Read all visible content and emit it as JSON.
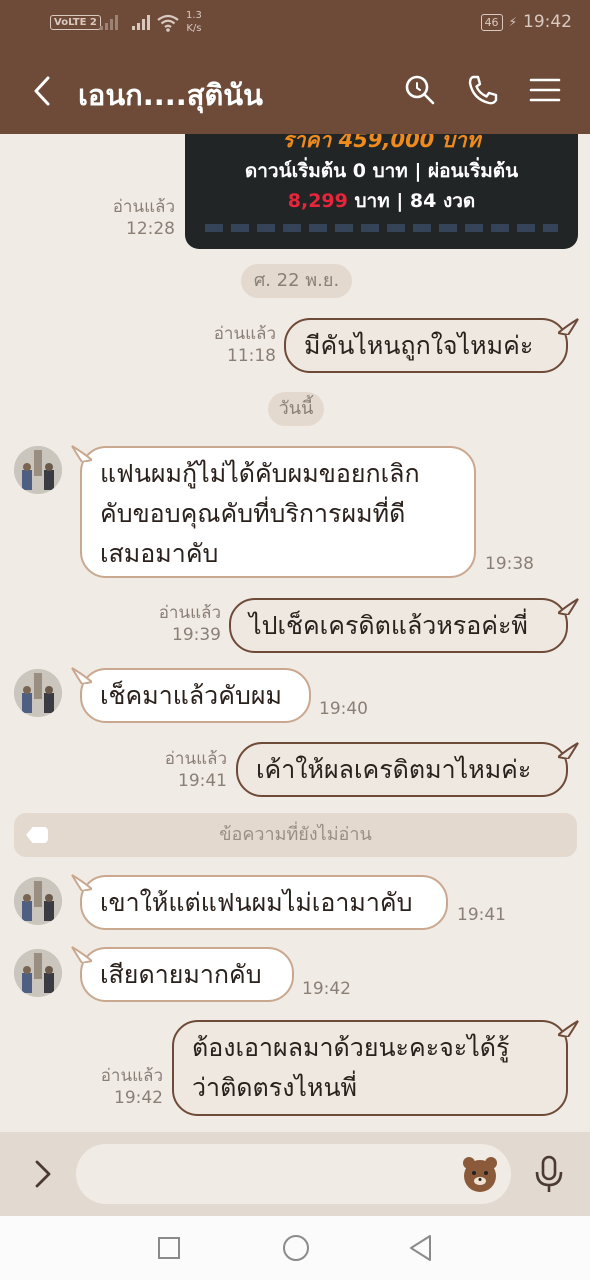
{
  "status_bar": {
    "carrier_badge": "VoLTE 2",
    "net_speed_value": "1.3",
    "net_speed_unit": "K/s",
    "battery": "46",
    "time": "19:42"
  },
  "header": {
    "title": "เอนก....สุตินัน",
    "icons": [
      "back-arrow-icon",
      "search-icon",
      "phone-icon",
      "menu-icon"
    ]
  },
  "promo": {
    "price_line": "ราคา 459,000 บาท",
    "down_line": "ดาวน์เริ่มต้น 0 บาท | ผ่อนเริ่มต้น",
    "install_amount": "8,299",
    "install_rest": "บาท | 84 งวด"
  },
  "promo_meta": {
    "read": "อ่านแล้ว",
    "time": "12:28"
  },
  "dates": {
    "friday": "ศ. 22 พ.ย.",
    "today": "วันนี้"
  },
  "messages": [
    {
      "dir": "out",
      "text": "มีคันไหนถูกใจไหมค่ะ",
      "read": "อ่านแล้ว",
      "time": "11:18"
    },
    {
      "dir": "in",
      "lines": [
        "แฟนผมกู้ไม่ได้คับผมขอยกเลิก",
        "คับขอบคุณคับที่บริการผมที่ดี",
        "เสมอมาคับ"
      ],
      "time": "19:38"
    },
    {
      "dir": "out",
      "text": "ไปเช็คเครดิตแล้วหรอค่ะพี่",
      "read": "อ่านแล้ว",
      "time": "19:39"
    },
    {
      "dir": "in",
      "text": "เช็คมาแล้วคับผม",
      "time": "19:40"
    },
    {
      "dir": "out",
      "text": "เค้าให้ผลเครดิตมาไหมค่ะ",
      "read": "อ่านแล้ว",
      "time": "19:41"
    },
    {
      "dir": "in",
      "text": "เขาให้แต่แฟนผมไม่เอามาคับ",
      "time": "19:41"
    },
    {
      "dir": "in",
      "text": "เสียดายมากคับ",
      "time": "19:42"
    },
    {
      "dir": "out",
      "lines": [
        "ต้องเอาผลมาด้วยนะคะจะได้รู้",
        "ว่าติดตรงไหนพี่"
      ],
      "read": "อ่านแล้ว",
      "time": "19:42"
    }
  ],
  "unread_divider": "ข้อความที่ยังไม่อ่าน",
  "input": {
    "value": "",
    "placeholder": ""
  },
  "colors": {
    "header": "#6e4a39",
    "chat_bg": "#f1ebe5",
    "outgoing_border": "#6e4a39",
    "incoming_border": "#c9a88f",
    "price_orange": "#ef8a1c",
    "price_red": "#e8253a"
  }
}
